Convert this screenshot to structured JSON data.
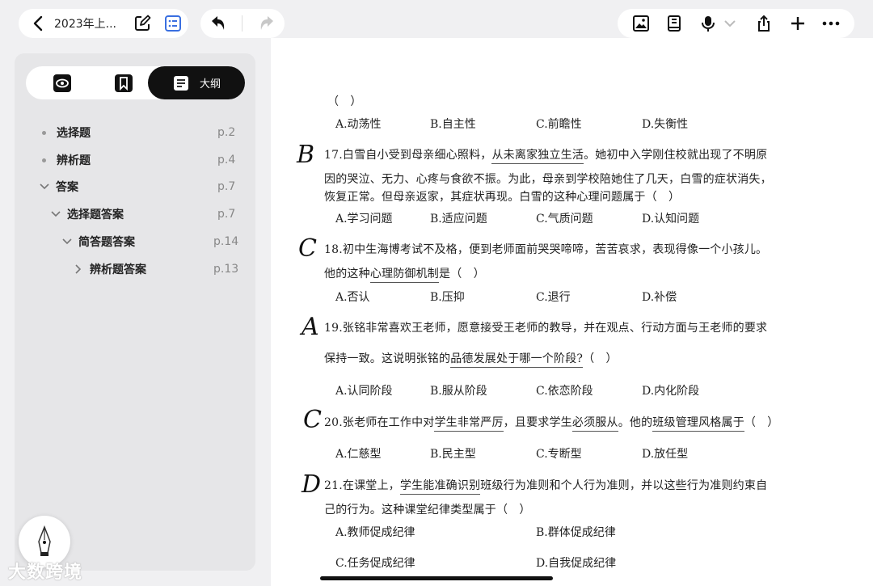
{
  "toolbar": {
    "doc_title": "2023年上...",
    "icons": [
      "back-icon",
      "edit-icon",
      "list-icon",
      "undo-icon",
      "redo-icon",
      "image-icon",
      "book-icon",
      "mic-icon",
      "chevron-down-icon",
      "share-icon",
      "plus-icon",
      "more-icon"
    ]
  },
  "sidebar": {
    "active_tab_label": "大纲",
    "outline": [
      {
        "label": "选择题",
        "page": "p.2"
      },
      {
        "label": "辨析题",
        "page": "p.4"
      },
      {
        "label": "答案",
        "page": "p.7"
      },
      {
        "label": "选择题答案",
        "page": "p.7"
      },
      {
        "label": "简答题答案",
        "page": "p.14"
      },
      {
        "label": "辨析题答案",
        "page": "p.13"
      }
    ]
  },
  "doc": {
    "q16_paren": "（　）",
    "q16_opts": [
      "A.动荡性",
      "B.自主性",
      "C.前瞻性",
      "D.失衡性"
    ],
    "q17_mark": "B",
    "q17_l1a": "17.白雪自小受到母亲细心照料，",
    "q17_l1u": "从未离家独立生活",
    "q17_l1b": "。她初中入学刚住校就出现了不明原",
    "q17_l2": "因的哭泣、无力、心疼与食欲不振。为此，母亲到学校陪她住了几天，白雪的症状消失，",
    "q17_l3": "恢复正常。但母亲返家，其症状再现。白雪的这种心理问题属于（　）",
    "q17_opts": [
      "A.学习问题",
      "B.适应问题",
      "C.气质问题",
      "D.认知问题"
    ],
    "q18_mark": "C",
    "q18_l1": "18.初中生海博考试不及格，便到老师面前哭哭啼啼，苦苦哀求，表现得像一个小孩儿。",
    "q18_l2a": "他的这种",
    "q18_l2u": "心理防御机制",
    "q18_l2b": "是（　）",
    "q18_opts": [
      "A.否认",
      "B.压抑",
      "C.退行",
      "D.补偿"
    ],
    "q19_mark": "A",
    "q19_l1": "19.张铭非常喜欢王老师，愿意接受王老师的教导，并在观点、行动方面与王老师的要求",
    "q19_l2a": "保持一致。这说明张铭的",
    "q19_l2u": "品德发展处于哪一个阶段?",
    "q19_l2b": "（　）",
    "q19_opts": [
      "A.认同阶段",
      "B.服从阶段",
      "C.依恋阶段",
      "D.内化阶段"
    ],
    "q20_mark": "C",
    "q20_a": "20.张老师在工作中对",
    "q20_u1": "学生非常严厉",
    "q20_b": "，且要求学生",
    "q20_u2": "必须服从",
    "q20_c": "。他的",
    "q20_u3": "班级管理风格属于",
    "q20_d": "（　）",
    "q20_opts": [
      "A.仁慈型",
      "B.民主型",
      "C.专断型",
      "D.放任型"
    ],
    "q21_mark": "D",
    "q21_l1a": "21.在课堂上，",
    "q21_l1u": "学生能准确识别",
    "q21_l1b": "班级行为准则和个人行为准则，并以这些行为准则约束自",
    "q21_l2": "己的行为。这种课堂纪律类型属于（　）",
    "q21_opts": [
      "A.教师促成纪律",
      "B.群体促成纪律",
      "C.任务促成纪律",
      "D.自我促成纪律"
    ]
  },
  "watermark": "大数跨境"
}
